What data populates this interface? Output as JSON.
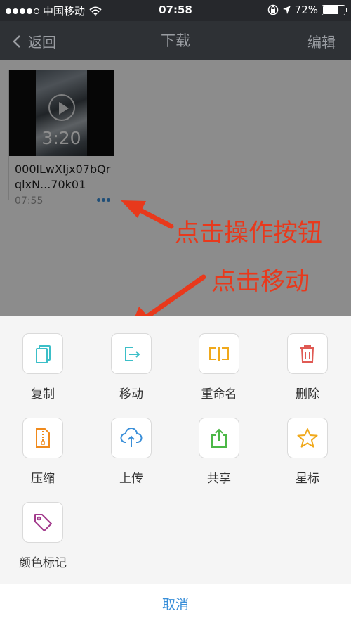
{
  "status_bar": {
    "carrier": "中国移动",
    "time": "07:58",
    "battery": "72%",
    "battery_level": 0.72,
    "icons": [
      "signal-dots",
      "wifi-icon",
      "rotation-lock-icon",
      "location-arrow-icon",
      "battery-icon"
    ]
  },
  "nav": {
    "back_label": "返回",
    "title": "下载",
    "edit_label": "编辑"
  },
  "video": {
    "duration": "3:20",
    "name": "000lLwXIjx07bQrqlxN...70k01",
    "time": "07:55"
  },
  "annotations": {
    "tap_more": "点击操作按钮",
    "tap_move": "点击移动"
  },
  "actions": [
    {
      "label": "复制",
      "icon": "copy-icon",
      "color": "#3cbfc8"
    },
    {
      "label": "移动",
      "icon": "move-icon",
      "color": "#3cbfc8"
    },
    {
      "label": "重命名",
      "icon": "rename-icon",
      "color": "#f0a91c"
    },
    {
      "label": "删除",
      "icon": "delete-icon",
      "color": "#e05a54"
    },
    {
      "label": "压缩",
      "icon": "compress-icon",
      "color": "#f08a1c"
    },
    {
      "label": "上传",
      "icon": "upload-icon",
      "color": "#3a8fd9"
    },
    {
      "label": "共享",
      "icon": "share-icon",
      "color": "#4cb847"
    },
    {
      "label": "星标",
      "icon": "star-icon",
      "color": "#f0a91c"
    },
    {
      "label": "颜色标记",
      "icon": "color-tag-icon",
      "color": "#a23a8c"
    }
  ],
  "cancel_label": "取消",
  "colors": {
    "accent": "#3a8fd9",
    "annotation": "#e8391c",
    "header_bg": "#2e3135"
  }
}
